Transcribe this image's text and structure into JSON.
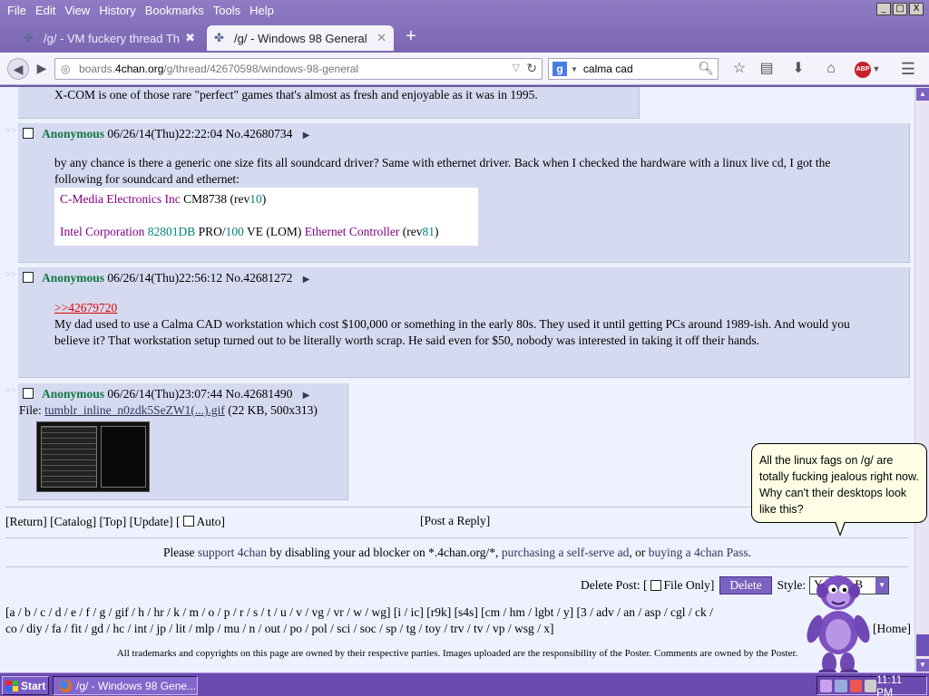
{
  "menubar": {
    "items": [
      "File",
      "Edit",
      "View",
      "History",
      "Bookmarks",
      "Tools",
      "Help"
    ],
    "window_controls": [
      "_",
      "□",
      "X"
    ]
  },
  "tabs": [
    {
      "title": "/g/ - VM fuckery thread Thi...",
      "active": false
    },
    {
      "title": "/g/ - Windows 98 General",
      "active": true
    }
  ],
  "navbar": {
    "url_prefix": "boards.",
    "url_host": "4chan.org",
    "url_path": "/g/thread/42670598/windows-98-general",
    "search_value": "calma cad",
    "search_engine_letter": "g",
    "abp_label": "ABP"
  },
  "thread": {
    "prev_post_tail": "X-COM is one of those rare \"perfect\" games that's almost as fresh and enjoyable as it was in 1995.",
    "posts": [
      {
        "name": "Anonymous",
        "datetime": "06/26/14(Thu)22:22:04",
        "number": "No.42680734",
        "text": "by any chance is there a generic one size fits all soundcard driver? Same with ethernet driver. Back when I checked the hardware with a linux live cd, I got the following for soundcard and ethernet:",
        "code_line1": {
          "vendor": "C-Media Electronics Inc",
          "model": "CM8738",
          "rev_label": "(rev",
          "rev": "10",
          "close": ")"
        },
        "code_line2": {
          "vendor": "Intel Corporation",
          "model": "82801DB",
          "pro": "PRO/",
          "pro_num": "100",
          "ve": "VE (LOM)",
          "dev": "Ethernet Controller",
          "rev_label": "(rev",
          "rev": "81",
          "close": ")"
        }
      },
      {
        "name": "Anonymous",
        "datetime": "06/26/14(Thu)22:56:12",
        "number": "No.42681272",
        "quote": ">>42679720",
        "text": "My dad used to use a Calma CAD workstation which cost $100,000 or something in the early 80s. They used it until getting PCs around 1989-ish. And would you believe it? That workstation setup turned out to be literally worth scrap. He said even for $50, nobody was interested in taking it off their hands."
      },
      {
        "name": "Anonymous",
        "datetime": "06/26/14(Thu)23:07:44",
        "number": "No.42681490",
        "file_label": "File:",
        "file_name": "tumblr_inline_n0zdk5SeZW1(...).gif",
        "file_info": "(22 KB, 500x313)"
      }
    ]
  },
  "thread_nav": {
    "return": "[Return]",
    "catalog": "[Catalog]",
    "top": "[Top]",
    "update": "[Update]",
    "auto_open": "[",
    "auto": "Auto]",
    "post_reply": "[Post a Reply]"
  },
  "adblock": {
    "pre": "Please",
    "link1": "support 4chan",
    "mid1": "by disabling your ad blocker on *.4chan.org/*,",
    "link2": "purchasing a self-serve ad",
    "mid2": ", or",
    "link3": "buying a 4chan Pass",
    "post": "."
  },
  "delete_area": {
    "label": "Delete Post: [",
    "file_only": "File Only]",
    "button": "Delete",
    "style_label": "Style:",
    "style_value": "Yotsuba B"
  },
  "boards": {
    "line1": "[a / b / c / d / e / f / g / gif / h / hr / k / m / o / p / r / s / t / u / v / vg / vr / w / wg] [i / ic] [r9k] [s4s] [cm / hm / lgbt / y] [3 / adv / an / asp / cgl / ck /",
    "line2": "co / diy / fa / fit / gd / hc / int / jp / lit / mlp / mu / n / out / po / pol / sci / soc / sp / tg / toy / trv / tv / vp / wsg / x]",
    "home": "[Home]"
  },
  "footer": "All trademarks and copyrights on this page are owned by their respective parties. Images uploaded are the responsibility of the Poster. Comments are owned by the Poster.",
  "bonzi": {
    "speech": "All the linux fags on /g/ are totally fucking jealous right now. Why can't their desktops look like this?"
  },
  "taskbar": {
    "start": "Start",
    "task": "/g/ - Windows 98 Gene...",
    "clock": "11:11 PM"
  },
  "colors": {
    "accent": "#7b62c0",
    "post_bg": "#d6daf0",
    "name_green": "#117743",
    "quote_red": "#dd0000"
  }
}
